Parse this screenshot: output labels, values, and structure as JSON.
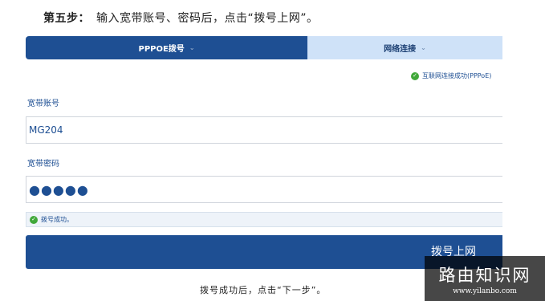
{
  "header": {
    "step_label": "第五步：",
    "step_text": "输入宽带账号、密码后，点击“拨号上网”。"
  },
  "tabs": [
    {
      "label": "PPPOE拨号",
      "active": true
    },
    {
      "label": "网络连接",
      "active": false
    }
  ],
  "connection_status": "互联网连接成功(PPPoE)",
  "account": {
    "label": "宽带账号",
    "value": "MG204"
  },
  "password": {
    "label": "宽带密码",
    "value": "●●●●●"
  },
  "dial_status": "拨号成功。",
  "dial_button": {
    "label": "拨号上网"
  },
  "footnote": "拨号成功后，点击“下一步”。",
  "watermark": {
    "title": "路由知识网",
    "url": "www.yilanbo.com"
  },
  "colors": {
    "primary": "#1e4f93",
    "tab_inactive": "#cfe2f8",
    "success": "#41a83a"
  },
  "icons": {
    "success": "check-circle-icon",
    "tab_dropdown": "chevron-down-icon"
  }
}
